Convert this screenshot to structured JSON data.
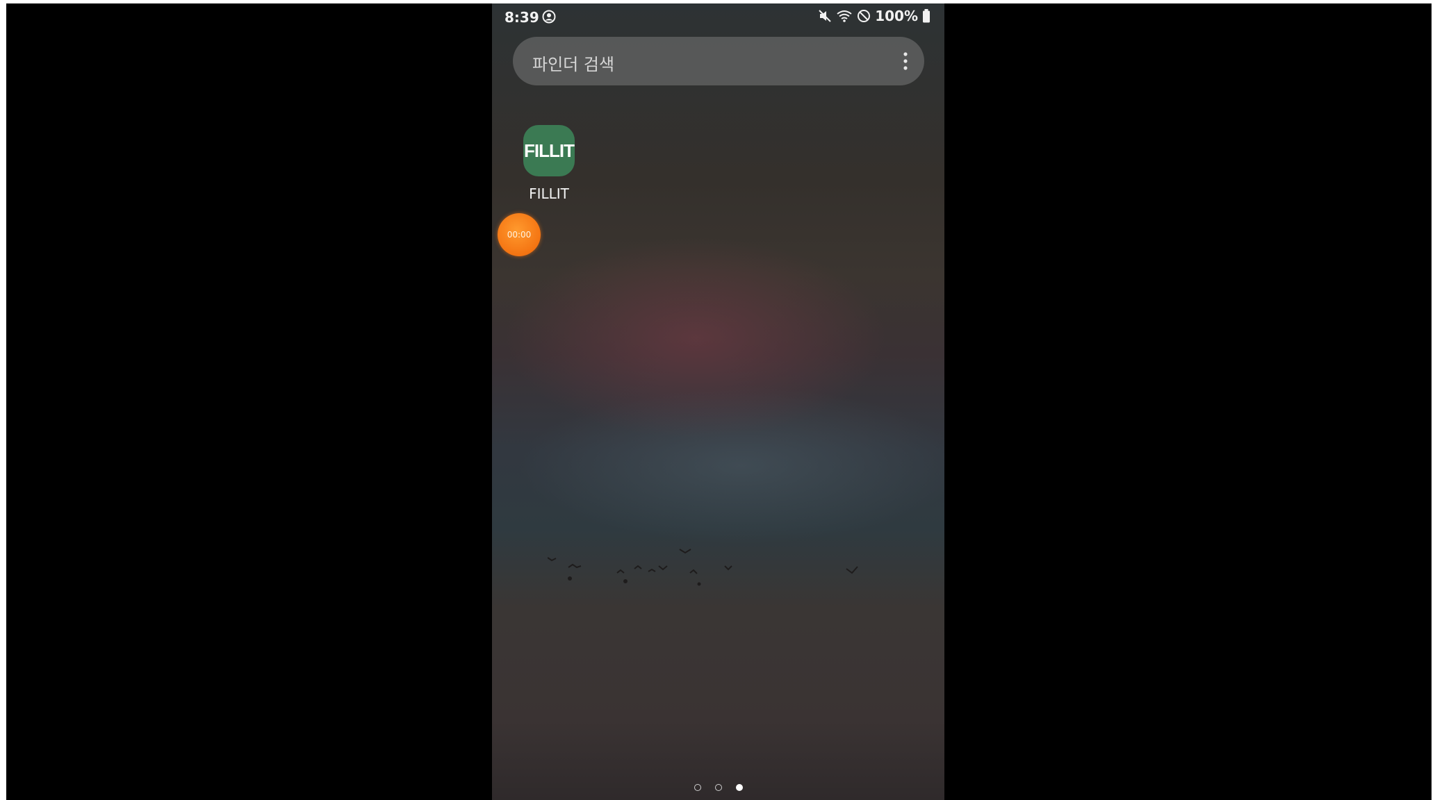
{
  "status_bar": {
    "time": "8:39",
    "battery_text": "100%",
    "icons": [
      "user-circle-icon",
      "mute-icon",
      "wifi-icon",
      "do-not-disturb-icon",
      "battery-icon"
    ]
  },
  "search": {
    "placeholder": "파인더 검색",
    "menu_icon": "more-vertical-icon"
  },
  "home_apps": [
    {
      "icon_text": "FILLIT",
      "label": "FILLIT",
      "color": "#3b7a53"
    }
  ],
  "floating_timer": {
    "text": "00:00",
    "color": "#f47412"
  },
  "pages": {
    "count": 3,
    "active_index": 2
  }
}
